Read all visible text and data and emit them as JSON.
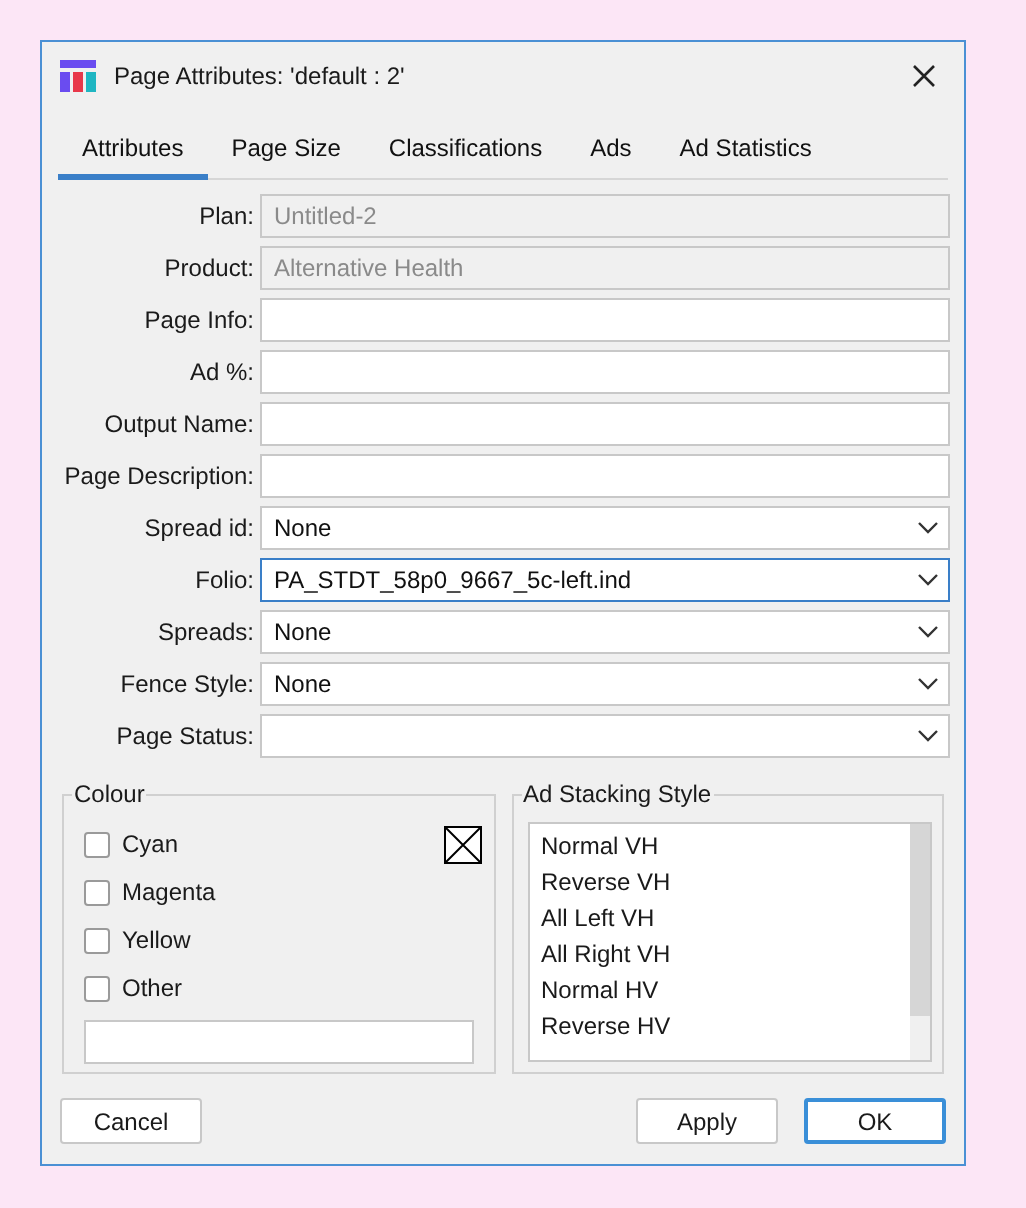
{
  "window": {
    "title": "Page Attributes: 'default : 2'"
  },
  "tabs": [
    {
      "label": "Attributes",
      "selected": true
    },
    {
      "label": "Page Size",
      "selected": false
    },
    {
      "label": "Classifications",
      "selected": false
    },
    {
      "label": "Ads",
      "selected": false
    },
    {
      "label": "Ad Statistics",
      "selected": false
    }
  ],
  "fields": [
    {
      "label": "Plan:",
      "kind": "text",
      "value": "Untitled-2",
      "disabled": true,
      "focused": false
    },
    {
      "label": "Product:",
      "kind": "text",
      "value": "Alternative Health",
      "disabled": true,
      "focused": false
    },
    {
      "label": "Page Info:",
      "kind": "text",
      "disabled": false,
      "focused": false
    },
    {
      "label": "Ad %:",
      "kind": "text",
      "disabled": false,
      "focused": false
    },
    {
      "label": "Output Name:",
      "kind": "text",
      "disabled": false,
      "focused": false
    },
    {
      "label": "Page Description:",
      "kind": "text",
      "disabled": false,
      "focused": false
    },
    {
      "label": "Spread id:",
      "kind": "select",
      "value": "None",
      "disabled": false,
      "focused": false
    },
    {
      "label": "Folio:",
      "kind": "select",
      "value": "PA_STDT_58p0_9667_5c-left.ind",
      "disabled": false,
      "focused": true
    },
    {
      "label": "Spreads:",
      "kind": "select",
      "value": "None",
      "disabled": false,
      "focused": false
    },
    {
      "label": "Fence Style:",
      "kind": "select",
      "value": "None",
      "disabled": false,
      "focused": false
    },
    {
      "label": "Page Status:",
      "kind": "select",
      "disabled": false,
      "focused": false
    }
  ],
  "colour": {
    "title": "Colour",
    "options": [
      {
        "label": "Cyan",
        "checked": false
      },
      {
        "label": "Magenta",
        "checked": false
      },
      {
        "label": "Yellow",
        "checked": false
      },
      {
        "label": "Other",
        "checked": false
      }
    ]
  },
  "ad_stacking": {
    "title": "Ad Stacking Style",
    "items": [
      {
        "label": "Normal VH",
        "selected": false
      },
      {
        "label": "Reverse VH",
        "selected": false
      },
      {
        "label": "All Left VH",
        "selected": false
      },
      {
        "label": "All Right VH",
        "selected": false
      },
      {
        "label": "Normal HV",
        "selected": false
      },
      {
        "label": "Reverse HV",
        "selected": false
      }
    ]
  },
  "buttons": [
    {
      "label": "Cancel",
      "default": false
    },
    {
      "label": "Apply",
      "default": false
    },
    {
      "label": "OK",
      "default": true
    }
  ]
}
